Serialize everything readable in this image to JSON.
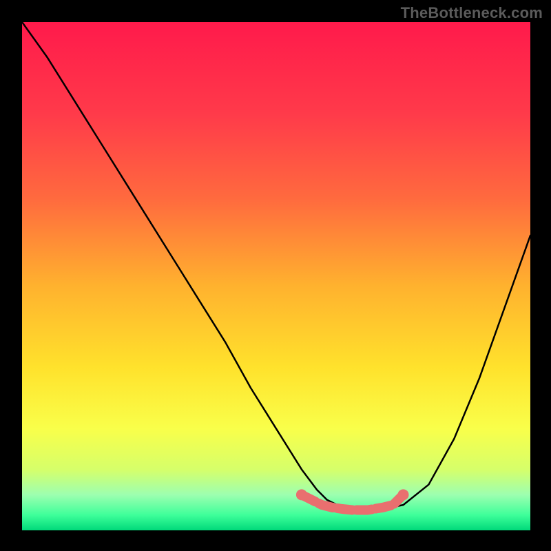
{
  "watermark": "TheBottleneck.com",
  "chart_data": {
    "type": "line",
    "title": "",
    "xlabel": "",
    "ylabel": "",
    "xlim": [
      0,
      100
    ],
    "ylim": [
      0,
      100
    ],
    "grid": false,
    "legend": false,
    "series": [
      {
        "name": "curve",
        "x": [
          0,
          5,
          10,
          15,
          20,
          25,
          30,
          35,
          40,
          45,
          50,
          55,
          58,
          60,
          62,
          65,
          70,
          75,
          80,
          85,
          90,
          95,
          100
        ],
        "y": [
          100,
          93,
          85,
          77,
          69,
          61,
          53,
          45,
          37,
          28,
          20,
          12,
          8,
          6,
          5,
          4,
          4,
          5,
          9,
          18,
          30,
          44,
          58
        ]
      }
    ],
    "background_gradient": {
      "stops": [
        {
          "offset": 0.0,
          "color": "#ff1a4b"
        },
        {
          "offset": 0.18,
          "color": "#ff3a4a"
        },
        {
          "offset": 0.35,
          "color": "#ff6b3e"
        },
        {
          "offset": 0.52,
          "color": "#ffb22e"
        },
        {
          "offset": 0.68,
          "color": "#ffe22c"
        },
        {
          "offset": 0.8,
          "color": "#f9ff4a"
        },
        {
          "offset": 0.88,
          "color": "#d6ff6a"
        },
        {
          "offset": 0.93,
          "color": "#9dffb0"
        },
        {
          "offset": 0.97,
          "color": "#3eff9a"
        },
        {
          "offset": 1.0,
          "color": "#00d97a"
        }
      ]
    },
    "trough_marker": {
      "color": "#e96f6f",
      "points_x": [
        55,
        57,
        59,
        61,
        63,
        65,
        68,
        71,
        73,
        75
      ],
      "points_y": [
        7,
        6,
        5,
        4.5,
        4.2,
        4,
        4,
        4.5,
        5,
        7
      ]
    }
  }
}
